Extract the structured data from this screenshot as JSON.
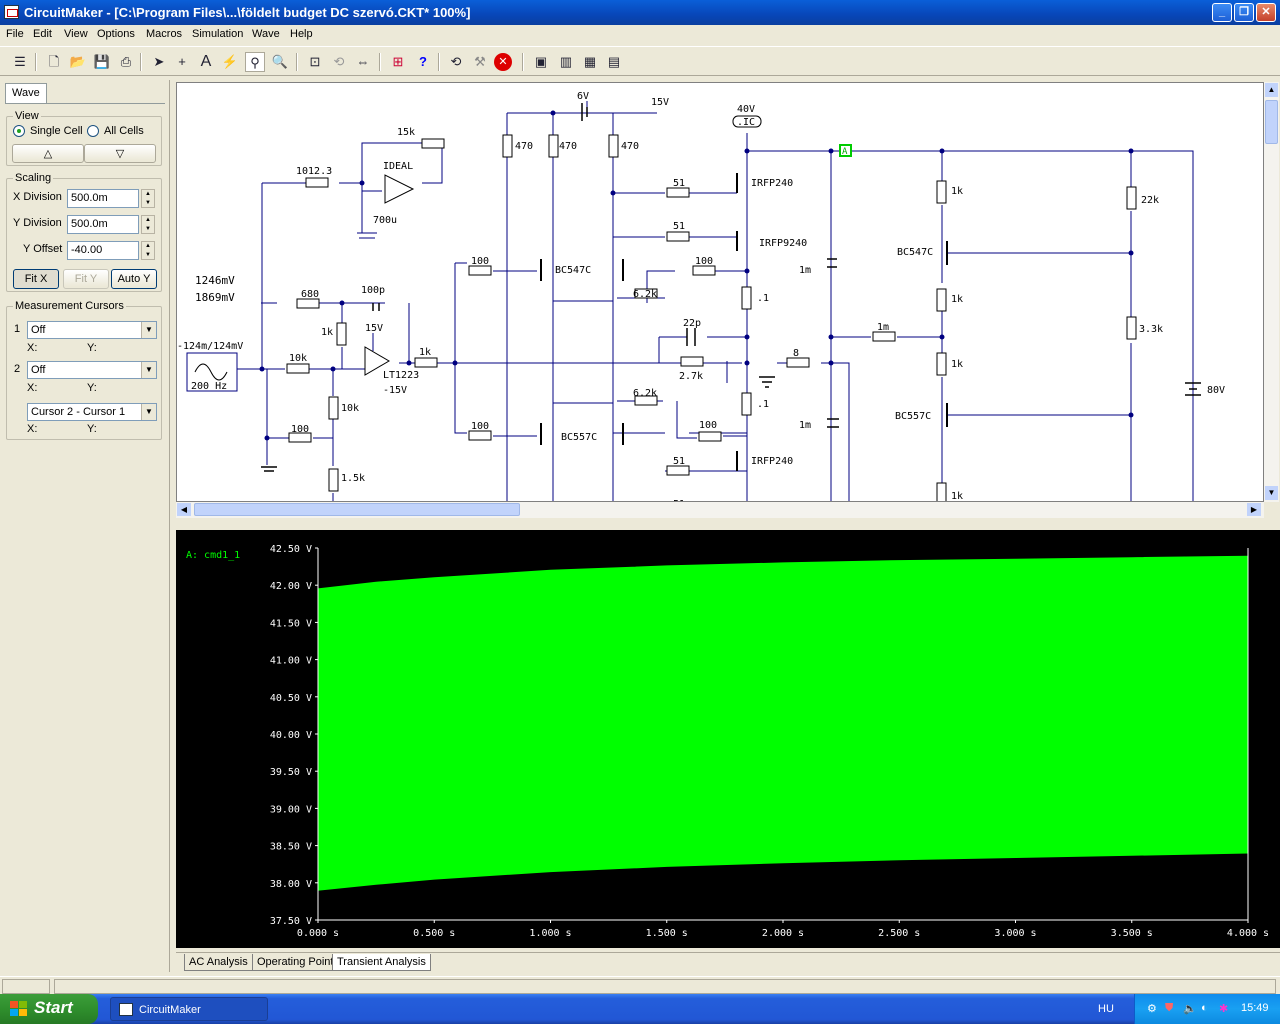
{
  "window": {
    "title": "CircuitMaker - [C:\\Program Files\\...\\földelt budget DC szervó.CKT* 100%]",
    "controls": [
      "minimize",
      "restore",
      "close"
    ]
  },
  "menu": [
    "File",
    "Edit",
    "View",
    "Options",
    "Macros",
    "Simulation",
    "Wave",
    "Help"
  ],
  "toolbar": {
    "icons": [
      "setup-icon",
      "new-file-icon",
      "open-folder-icon",
      "save-icon",
      "print-icon",
      "arrow-icon",
      "wire-icon",
      "text-icon",
      "probe-icon",
      "zoom-tool-icon",
      "search-icon",
      "zoom-window-icon",
      "rotate-icon",
      "mirror-icon",
      "netlist-icon",
      "help-icon",
      "undo-icon",
      "tools-icon",
      "stop-icon",
      "analysis-1-icon",
      "analysis-2-icon",
      "analysis-3-icon",
      "analysis-4-icon"
    ]
  },
  "panel": {
    "tab": "Wave",
    "view": {
      "label": "View",
      "single": "Single Cell",
      "all": "All Cells",
      "up": "△",
      "down": "▽"
    },
    "scaling": {
      "label": "Scaling",
      "xdiv_label": "X Division",
      "xdiv": "500.0m",
      "ydiv_label": "Y Division",
      "ydiv": "500.0m",
      "yoff_label": "Y Offset",
      "yoff": "-40.00",
      "fitx": "Fit X",
      "fity": "Fit Y",
      "autoy": "Auto Y"
    },
    "cursors": {
      "label": "Measurement Cursors",
      "c1_num": "1",
      "c1_value": "Off",
      "c2_num": "2",
      "c2_value": "Off",
      "x": "X:",
      "y": "Y:",
      "diff": "Cursor 2 - Cursor 1"
    }
  },
  "schematic": {
    "labels": {
      "r_1012": "1012.3",
      "ideal": "IDEAL",
      "r_15k": "15k",
      "c_700u": "700u",
      "mv1": "1246mV",
      "mv2": "1869mV",
      "r_680": "680",
      "c_100p": "100p",
      "r_1k_a": "1k",
      "v15": "15V",
      "gen": "-124m/124mV",
      "hz": "200 Hz",
      "r_10k_a": "10k",
      "r_1k_b": "1k",
      "lt1223": "LT1223",
      "vneg15": "-15V",
      "r_10k_b": "10k",
      "r_100_a": "100",
      "r_1_5k": "1.5k",
      "v6": "6V",
      "v15b": "15V",
      "r_470_a": "470",
      "r_470_b": "470",
      "r_470_c": "470",
      "v40": "40V",
      "ic": ".IC",
      "r_51_a": "51",
      "irfp240_a": "IRFP240",
      "r_51_b": "51",
      "irfp9240": "IRFP9240",
      "r_100_b": "100",
      "bc547c_a": "BC547C",
      "r_100_c": "100",
      "r_6_2k_a": "6.2k",
      "c_1m_a": "1m",
      "r_01_a": ".1",
      "c_22p": "22p",
      "r_2_7k": "2.7k",
      "r_8": "8",
      "r_1m": "1m",
      "r_01_b": ".1",
      "r_6_2k_b": "6.2k",
      "r_100_d": "100",
      "bc557c_a": "BC557C",
      "r_100_e": "100",
      "c_1m_b": "1m",
      "r_51_c": "51",
      "irfp240_b": "IRFP240",
      "r_51_d": "51",
      "r_1k_c": "1k",
      "bc547c_b": "BC547C",
      "r_1k_d": "1k",
      "r_1k_e": "1k",
      "bc557c_b": "BC557C",
      "r_1k_f": "1k",
      "r_22k": "22k",
      "r_3_3k": "3.3k",
      "v80": "80V",
      "probe": "A"
    }
  },
  "scope": {
    "trace_label": "A: cmd1_1",
    "trace_color": "#00ff00",
    "y_ticks": [
      "42.50 V",
      "42.00 V",
      "41.50 V",
      "41.00 V",
      "40.50 V",
      "40.00 V",
      "39.50 V",
      "39.00 V",
      "38.50 V",
      "38.00 V",
      "37.50 V"
    ],
    "x_ticks": [
      "0.000 s",
      "0.500 s",
      "1.000 s",
      "1.500 s",
      "2.000 s",
      "2.500 s",
      "3.000 s",
      "3.500 s",
      "4.000 s"
    ]
  },
  "chart_data": {
    "type": "area",
    "title": "A: cmd1_1",
    "xlabel": "",
    "ylabel": "",
    "xlim": [
      0,
      4
    ],
    "ylim": [
      37.5,
      42.5
    ],
    "x": [
      0,
      0.25,
      0.5,
      1.0,
      1.5,
      2.0,
      2.5,
      3.0,
      3.5,
      4.0
    ],
    "series": [
      {
        "name": "A: cmd1_1",
        "upper": [
          41.95,
          42.04,
          42.1,
          42.2,
          42.26,
          42.3,
          42.33,
          42.35,
          42.37,
          42.39
        ],
        "lower": [
          37.9,
          37.98,
          38.05,
          38.15,
          38.22,
          38.27,
          38.31,
          38.34,
          38.37,
          38.4
        ]
      }
    ],
    "grid": false,
    "color": "#00ff00"
  },
  "bottom_tabs": [
    "AC Analysis",
    "Operating Point",
    "Transient Analysis"
  ],
  "taskbar": {
    "start": "Start",
    "task": "CircuitMaker",
    "lang": "HU",
    "clock": "15:49"
  }
}
